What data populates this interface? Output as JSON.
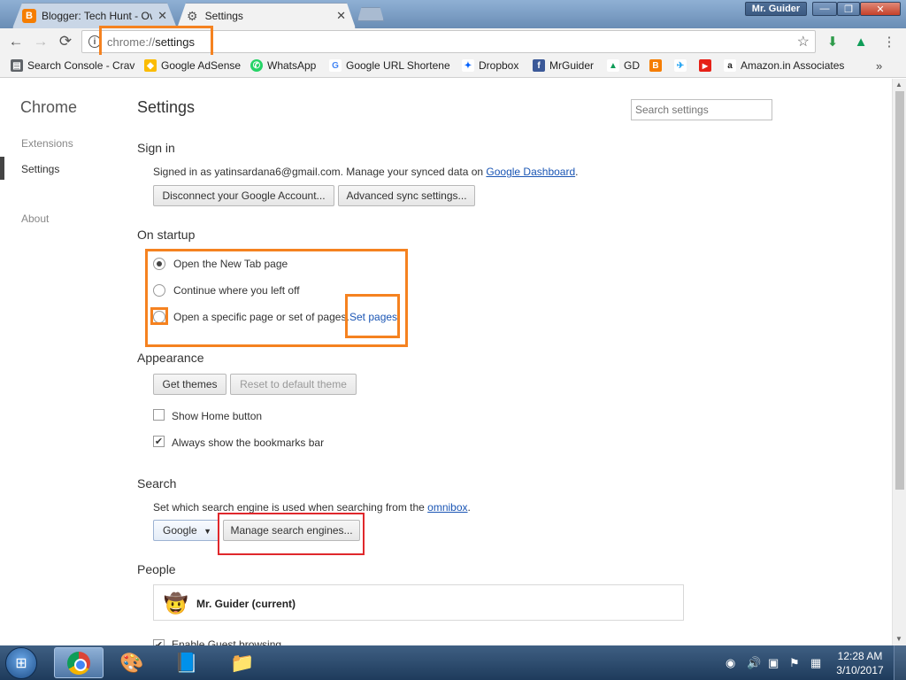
{
  "window": {
    "tabs": [
      {
        "title": "Blogger: Tech Hunt - Ov",
        "close": "✕"
      },
      {
        "title": "Settings",
        "close": "✕"
      }
    ],
    "user_badge": "Mr. Guider",
    "buttons": {
      "minimize": "—",
      "maximize": "❐",
      "close": "✕"
    }
  },
  "toolbar": {
    "back": "←",
    "forward": "→",
    "reload": "⟳",
    "url_scheme": "chrome://",
    "url_path": "settings",
    "star": "☆"
  },
  "bookmarks": [
    {
      "label": "Search Console - Crav",
      "icon": "search-console-icon",
      "color": "#5f6368",
      "glyph": "▤"
    },
    {
      "label": "Google AdSense",
      "icon": "adsense-icon",
      "color": "#fbbc04",
      "glyph": "◆"
    },
    {
      "label": "WhatsApp",
      "icon": "whatsapp-icon",
      "color": "#25d366",
      "glyph": "✆"
    },
    {
      "label": "Google URL Shortene",
      "icon": "google-icon",
      "color": "#4285f4",
      "glyph": "G"
    },
    {
      "label": "Dropbox",
      "icon": "dropbox-icon",
      "color": "#0061fe",
      "glyph": "✦"
    },
    {
      "label": "MrGuider",
      "icon": "facebook-icon",
      "color": "#3b5998",
      "glyph": "f"
    },
    {
      "label": "GD",
      "icon": "drive-icon",
      "color": "#0f9d58",
      "glyph": "▲"
    },
    {
      "label": "",
      "icon": "blogger-icon",
      "color": "#f57d00",
      "glyph": "B"
    },
    {
      "label": "",
      "icon": "twitter-icon",
      "color": "#1da1f2",
      "glyph": "✈"
    },
    {
      "label": "",
      "icon": "youtube-icon",
      "color": "#e62117",
      "glyph": "▶"
    },
    {
      "label": "Amazon.in Associates",
      "icon": "amazon-icon",
      "color": "#222222",
      "glyph": "a"
    }
  ],
  "bookmarks_more": "»",
  "sidebar": {
    "title": "Chrome",
    "items": [
      {
        "label": "Extensions"
      },
      {
        "label": "Settings"
      },
      {
        "label": "About"
      }
    ]
  },
  "settings": {
    "title": "Settings",
    "search_placeholder": "Search settings",
    "sign_in": {
      "title": "Sign in",
      "text_prefix": "Signed in as yatinsardana6@gmail.com. Manage your synced data on ",
      "dashboard_link": "Google Dashboard",
      "text_suffix": ".",
      "disconnect_button": "Disconnect your Google Account...",
      "advanced_sync_button": "Advanced sync settings..."
    },
    "on_startup": {
      "title": "On startup",
      "option_new_tab": "Open the New Tab page",
      "option_continue": "Continue where you left off",
      "option_specific": "Open a specific page or set of pages.",
      "set_pages_link": "Set pages"
    },
    "appearance": {
      "title": "Appearance",
      "get_themes_button": "Get themes",
      "reset_theme_button": "Reset to default theme",
      "show_home_button": "Show Home button",
      "always_show_bookmarks": "Always show the bookmarks bar"
    },
    "search": {
      "title": "Search",
      "text_prefix": "Set which search engine is used when searching from the ",
      "omnibox_link": "omnibox",
      "text_suffix": ".",
      "engine_selected": "Google",
      "manage_button": "Manage search engines..."
    },
    "people": {
      "title": "People",
      "current_user": "Mr. Guider (current)",
      "guest_browsing": "Enable Guest browsing"
    }
  },
  "taskbar": {
    "clock_time": "12:28 AM",
    "clock_date": "3/10/2017"
  }
}
